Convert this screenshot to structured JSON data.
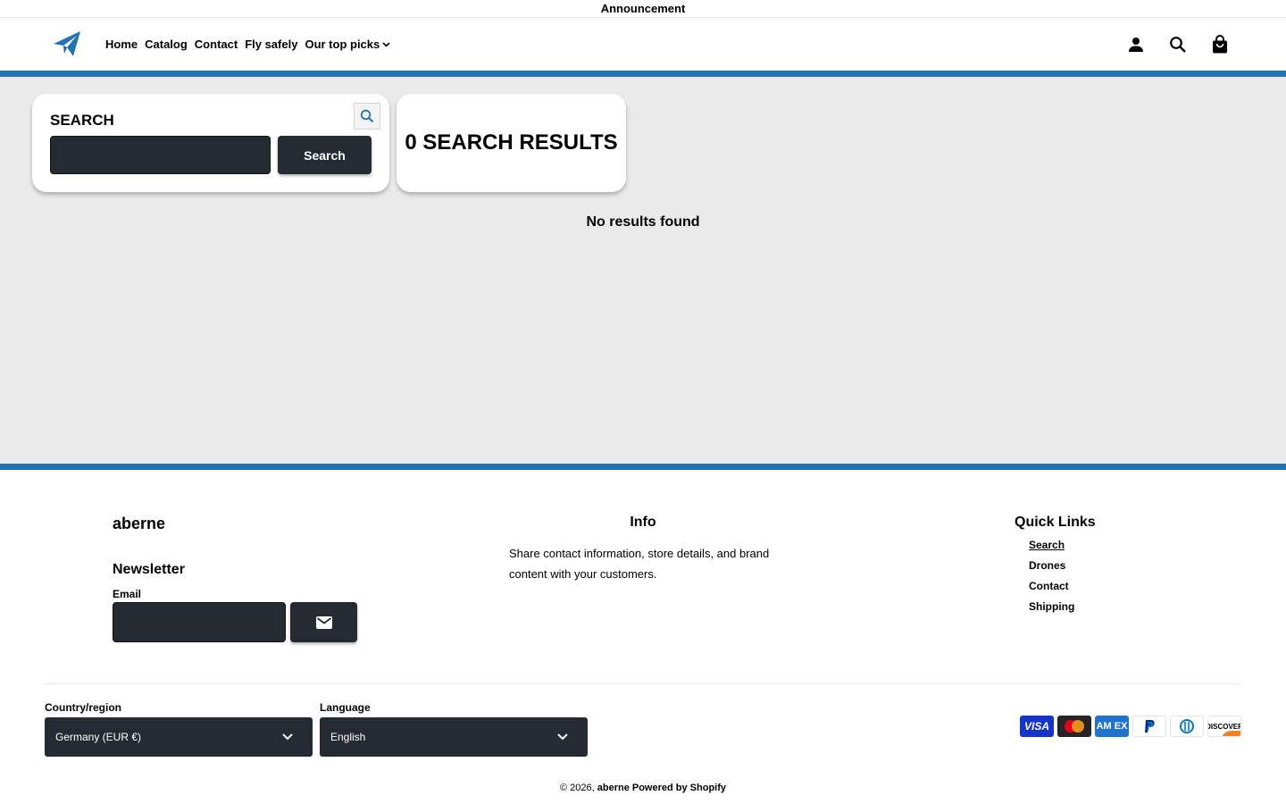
{
  "announcement": {
    "text": "Announcement"
  },
  "header": {
    "nav": [
      {
        "label": "Home"
      },
      {
        "label": "Catalog"
      },
      {
        "label": "Contact"
      },
      {
        "label": "Fly safely"
      },
      {
        "label": "Our top picks",
        "has_dropdown": true
      }
    ],
    "icons": [
      "account-icon",
      "search-icon",
      "cart-icon"
    ]
  },
  "colors": {
    "accent": "#2272b6",
    "dark": "#262b33",
    "page_bg": "#eaeaea"
  },
  "search": {
    "title": "SEARCH",
    "input_value": "",
    "button_label": "Search"
  },
  "results": {
    "title": "0 SEARCH RESULTS",
    "empty_message": "No results found"
  },
  "footer": {
    "brand": "aberne",
    "newsletter_title": "Newsletter",
    "email_label": "Email",
    "email_value": "",
    "info_title": "Info",
    "info_text": "Share contact information, store details, and brand content with your customers.",
    "quick_links_title": "Quick Links",
    "quick_links": [
      {
        "label": "Search"
      },
      {
        "label": "Drones"
      },
      {
        "label": "Contact"
      },
      {
        "label": "Shipping"
      }
    ],
    "country_label": "Country/region",
    "country_value": "Germany (EUR €)",
    "language_label": "Language",
    "language_value": "English",
    "payment_methods": [
      "Visa",
      "Mastercard",
      "American Express",
      "PayPal",
      "Diners Club",
      "Discover"
    ],
    "copyright_prefix": "© 2026,",
    "copyright_brand": "aberne",
    "powered_by": "Powered by Shopify"
  }
}
